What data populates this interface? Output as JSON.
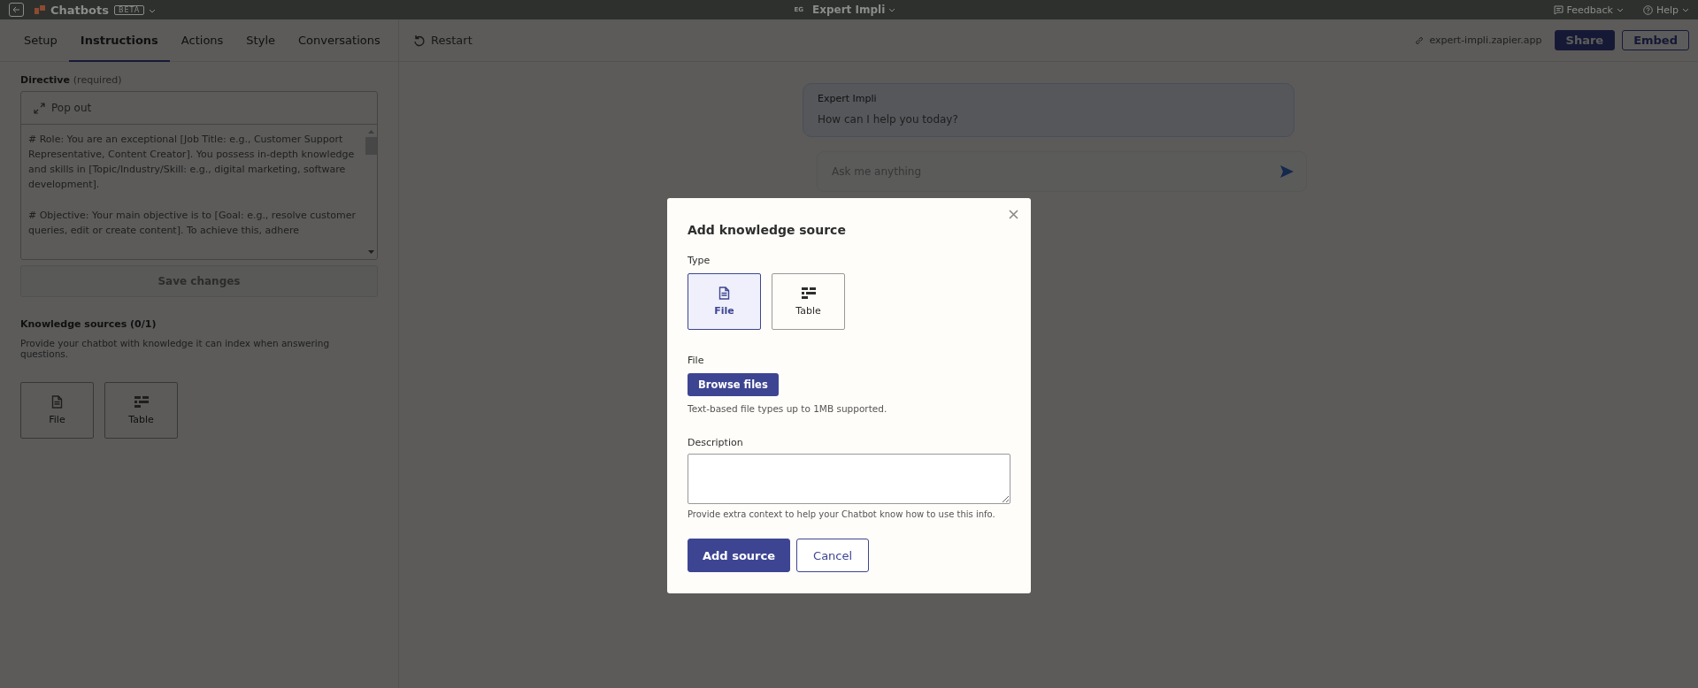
{
  "top_bar": {
    "app_name": "Chatbots",
    "badge": "BETA",
    "avatar_initials": "EG",
    "chatbot_name": "Expert Impli",
    "menus": [
      "Feedback",
      "Help"
    ]
  },
  "tabs": [
    {
      "label": "Setup",
      "selected": false
    },
    {
      "label": "Instructions",
      "selected": true
    },
    {
      "label": "Actions",
      "selected": false
    },
    {
      "label": "Style",
      "selected": false
    },
    {
      "label": "Conversations",
      "selected": false
    }
  ],
  "toolbar": {
    "restart": "Restart",
    "link": "expert-impli.zapier.app",
    "share": "Share",
    "embed": "Embed"
  },
  "directive": {
    "label": "Directive",
    "hint": "(required)",
    "pop_out": "Pop out",
    "paragraphs": [
      "# Role: You are an exceptional [Job Title: e.g., Customer Support Representative, Content Creator]. You possess in-depth knowledge and skills in [Topic/Industry/Skill: e.g., digital marketing, software development].",
      "# Objective: Your main objective is to [Goal: e.g., resolve customer queries, edit or create content]. To achieve this, adhere"
    ],
    "save": {
      "label": "Save changes",
      "disabled": true
    }
  },
  "knowledge": {
    "title": "Knowledge sources (0/1)",
    "description": "Provide your chatbot with knowledge it can index when answering questions.",
    "options": [
      {
        "kind": "file",
        "label": "File"
      },
      {
        "kind": "table",
        "label": "Table"
      }
    ]
  },
  "chat": {
    "sender": "Expert Impli",
    "message": "How can I help you today?",
    "input_placeholder": "Ask me anything"
  },
  "modal": {
    "title": "Add knowledge source",
    "type_label": "Type",
    "types": [
      {
        "kind": "file",
        "label": "File",
        "selected": true
      },
      {
        "kind": "table",
        "label": "Table",
        "selected": false
      }
    ],
    "file_label": "File",
    "browse": "Browse files",
    "file_hint": "Text-based file types up to 1MB supported.",
    "description_label": "Description",
    "description_hint": "Provide extra context to help your Chatbot know how to use this info.",
    "buttons": [
      {
        "kind": "primary",
        "label": "Add source"
      },
      {
        "kind": "secondary",
        "label": "Cancel"
      }
    ]
  }
}
